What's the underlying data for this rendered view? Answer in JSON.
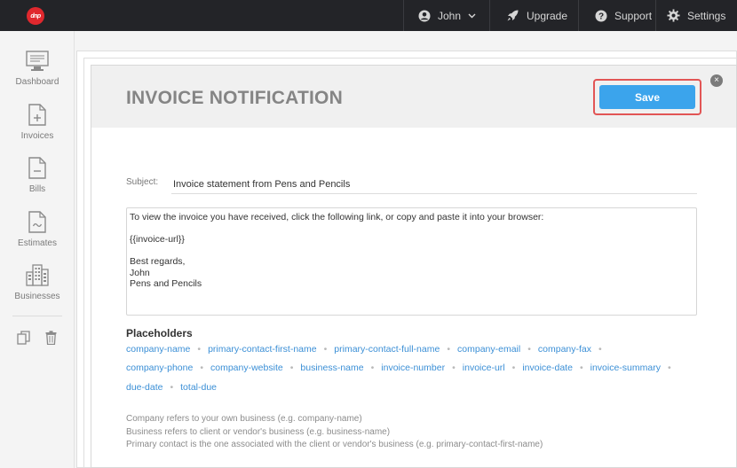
{
  "app": {
    "logo_text": "dnp"
  },
  "topnav": {
    "user": "John",
    "upgrade": "Upgrade",
    "support": "Support",
    "settings": "Settings"
  },
  "sidebar": {
    "items": [
      {
        "label": "Dashboard",
        "icon": "monitor-icon"
      },
      {
        "label": "Invoices",
        "icon": "invoice-icon"
      },
      {
        "label": "Bills",
        "icon": "bill-icon"
      },
      {
        "label": "Estimates",
        "icon": "estimate-icon"
      },
      {
        "label": "Businesses",
        "icon": "buildings-icon"
      }
    ],
    "tools": [
      "copy-icon",
      "trash-icon"
    ]
  },
  "card": {
    "title": "INVOICE NOTIFICATION",
    "save_label": "Save",
    "close_label": "×",
    "subject_label": "Subject:",
    "subject_value": "Invoice statement from Pens and Pencils",
    "body_value": "To view the invoice you have received, click the following link, or copy and paste it into your browser:\n\n{{invoice-url}}\n\nBest regards,\nJohn\nPens and Pencils"
  },
  "placeholders": {
    "title": "Placeholders",
    "rows": [
      [
        "company-name",
        "primary-contact-first-name",
        "primary-contact-full-name",
        "company-email",
        "company-fax"
      ],
      [
        "company-phone",
        "company-website",
        "business-name",
        "invoice-number",
        "invoice-url",
        "invoice-date",
        "invoice-summary"
      ],
      [
        "due-date",
        "total-due"
      ]
    ]
  },
  "notes": [
    "Company refers to your own business (e.g. company-name)",
    "Business refers to client or vendor's business (e.g. business-name)",
    "Primary contact is the one associated with the client or vendor's business (e.g. primary-contact-first-name)"
  ]
}
